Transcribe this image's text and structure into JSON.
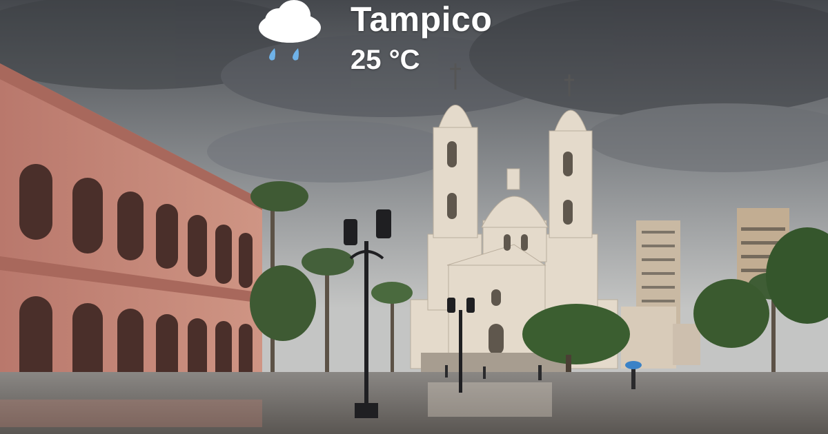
{
  "weather": {
    "city": "Tampico",
    "temperature": "25 °C",
    "condition_icon": "rain-cloud-icon"
  },
  "colors": {
    "sky_dark": "#4a4d52",
    "sky_light": "#a9acae",
    "building_pink": "#c98a7d",
    "cathedral": "#e6dccd",
    "plaza": "#6e6a66"
  }
}
